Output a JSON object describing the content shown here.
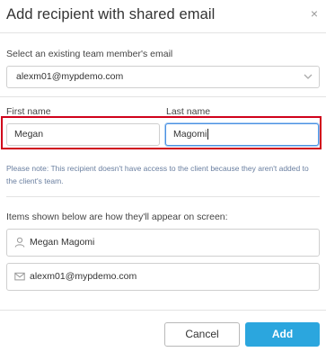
{
  "dialog": {
    "title": "Add recipient with shared email",
    "close_icon": "×"
  },
  "team_select": {
    "label": "Select an existing team member's email",
    "value": "alexm01@mypdemo.com"
  },
  "name_fields": {
    "first_label": "First name",
    "first_value": "Megan",
    "last_label": "Last name",
    "last_value": "Magomi"
  },
  "note": "Please note: This recipient doesn't have access to the client because they aren't added to the client's team.",
  "preview": {
    "label": "Items shown below are how they'll appear on screen:",
    "name": "Megan Magomi",
    "email": "alexm01@mypdemo.com"
  },
  "buttons": {
    "cancel": "Cancel",
    "add": "Add"
  },
  "colors": {
    "accent": "#2ba6de",
    "highlight": "#d0021b",
    "focus": "#4a90e2",
    "note": "#6a7fa0"
  }
}
